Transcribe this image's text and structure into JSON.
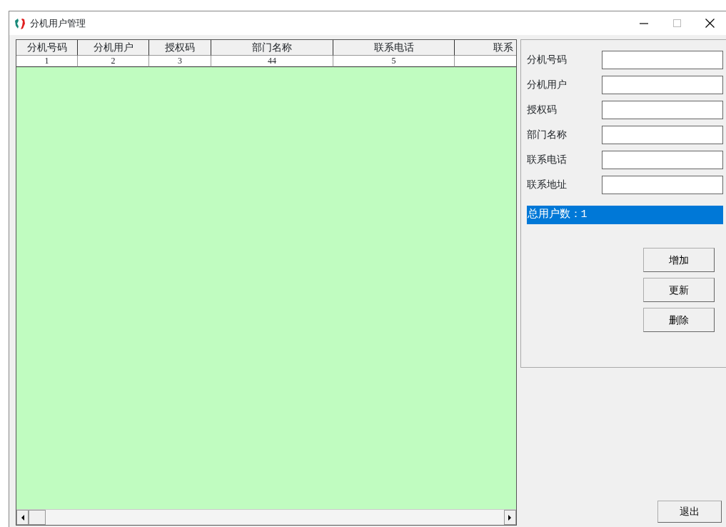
{
  "window": {
    "title": "分机用户管理"
  },
  "table": {
    "columns": [
      "分机号码",
      "分机用户",
      "授权码",
      "部门名称",
      "联系电话",
      "联系"
    ],
    "rows": [
      [
        "1",
        "2",
        "3",
        "44",
        "5"
      ]
    ]
  },
  "form": {
    "fields": [
      {
        "label": "分机号码"
      },
      {
        "label": "分机用户"
      },
      {
        "label": "授权码"
      },
      {
        "label": "部门名称"
      },
      {
        "label": "联系电话"
      },
      {
        "label": "联系地址"
      }
    ],
    "summary": "总用户数：1",
    "buttons": [
      "增加",
      "更新",
      "删除"
    ]
  },
  "exit_button": "退出"
}
